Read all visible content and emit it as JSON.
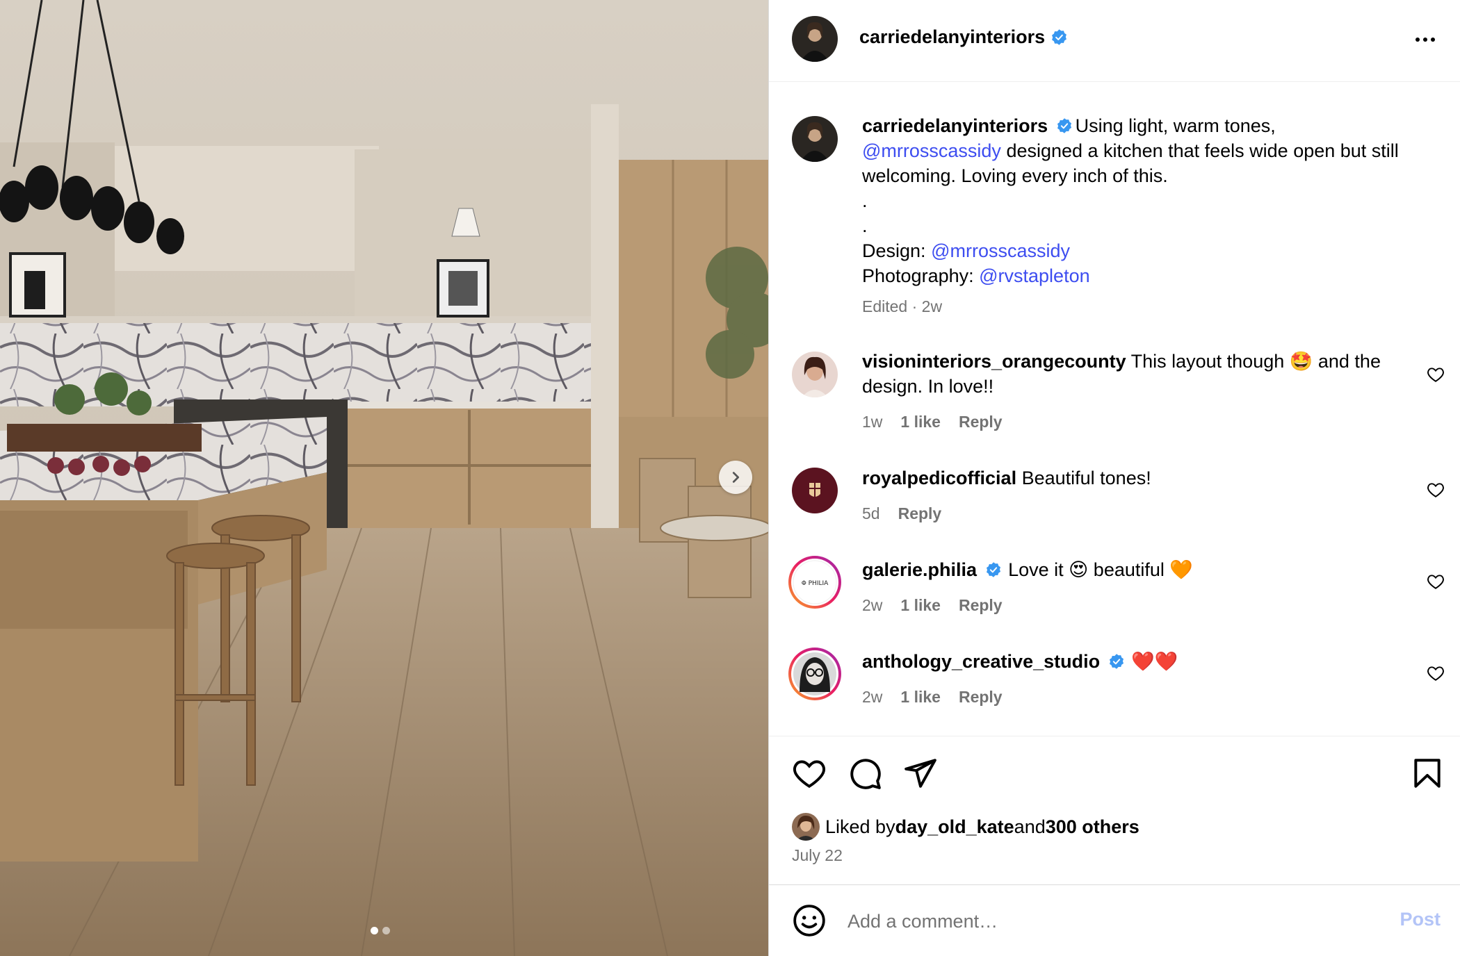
{
  "post": {
    "username": "carriedelanyinteriors",
    "verified": true,
    "photo_alt": "Kitchen with marble island, wood cabinets and stools",
    "carousel": {
      "total": 2,
      "current": 1
    }
  },
  "caption": {
    "username": "carriedelanyinteriors",
    "text_pre": "Using light, warm tones, ",
    "mention_1": "@mrrosscassidy",
    "text_post": " designed a kitchen that feels wide open but still welcoming. Loving every inch of this.",
    "dot_1": ".",
    "dot_2": ".",
    "design_label": "Design: ",
    "design_mention": "@mrrosscassidy",
    "photo_label": "Photography: ",
    "photo_mention": "@rvstapleton",
    "meta": "Edited · 2w"
  },
  "comments": [
    {
      "username": "visioninteriors_orangecounty",
      "text_a": " This layout though ",
      "emoji": "🤩",
      "text_b": " and the design. In love!!",
      "time": "1w",
      "likes": "1 like",
      "reply": "Reply"
    },
    {
      "username": "royalpedicofficial",
      "text": " Beautiful tones!",
      "time": "5d",
      "reply": "Reply"
    },
    {
      "username": "galerie.philia",
      "text_a": " Love it ",
      "emoji": "😍",
      "text_b": " beautiful ",
      "emoji_2": "🧡",
      "time": "2w",
      "likes": "1 like",
      "reply": "Reply",
      "avatar_text": "Φ PHILIA"
    },
    {
      "username": "anthology_creative_studio",
      "text": " ❤️❤️",
      "time": "2w",
      "likes": "1 like",
      "reply": "Reply"
    }
  ],
  "likes": {
    "prefix": "Liked by ",
    "user": "day_old_kate",
    "mid": " and ",
    "others": "300 others"
  },
  "date": "July 22",
  "add_comment": {
    "placeholder": "Add a comment…",
    "post_label": "Post"
  },
  "colors": {
    "mention": "#3d4df0",
    "verified": "#3897f0",
    "post_disabled": "#b3c4f7",
    "muted": "#737373"
  },
  "icons": [
    "more-icon",
    "heart-icon",
    "comment-icon",
    "share-icon",
    "bookmark-icon",
    "emoji-icon",
    "chevron-right-icon",
    "verified-icon"
  ]
}
